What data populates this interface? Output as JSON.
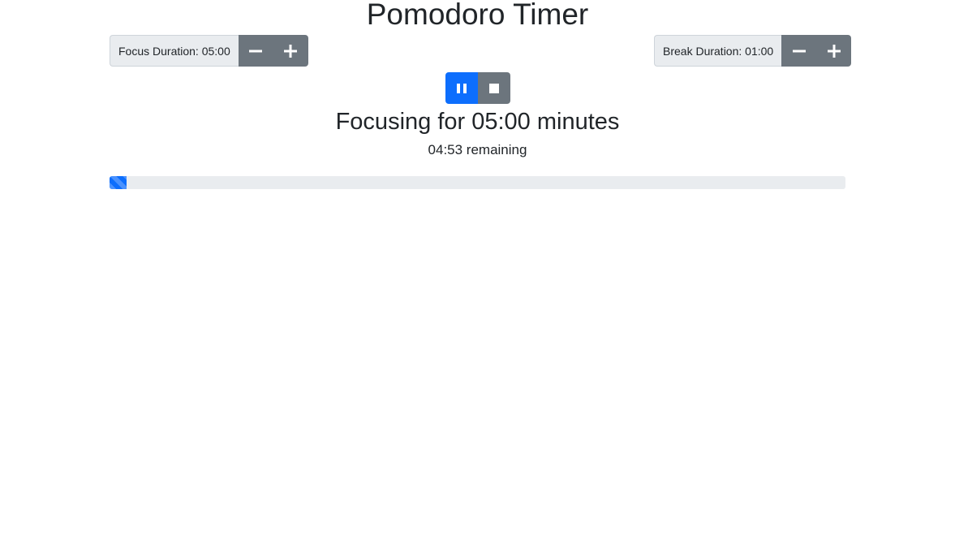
{
  "page": {
    "title": "Pomodoro Timer"
  },
  "focus": {
    "label": "Focus Duration: 05:00",
    "decrement_icon": "minus-icon",
    "increment_icon": "plus-icon"
  },
  "break": {
    "label": "Break Duration: 01:00",
    "decrement_icon": "minus-icon",
    "increment_icon": "plus-icon"
  },
  "controls": {
    "pause_icon": "pause-icon",
    "stop_icon": "stop-icon"
  },
  "status": {
    "heading": "Focusing for 05:00 minutes",
    "remaining": "04:53 remaining"
  },
  "progress": {
    "percent": 2.33
  },
  "colors": {
    "primary": "#0d6efd",
    "secondary": "#6c757d",
    "track": "#e9ecef"
  }
}
